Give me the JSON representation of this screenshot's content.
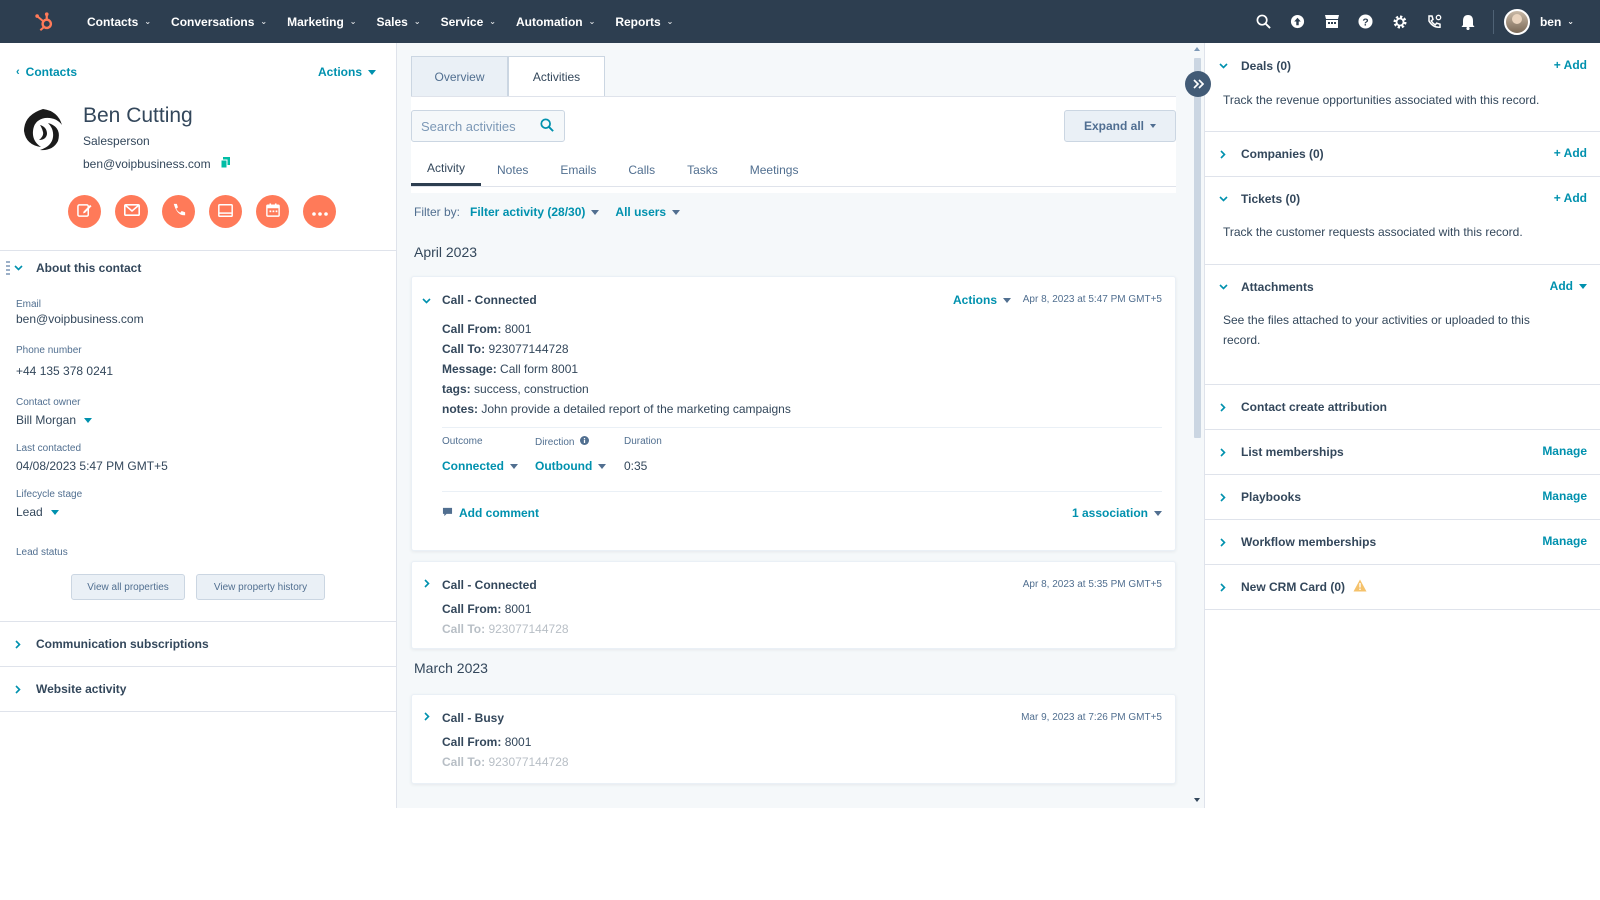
{
  "nav": {
    "items": [
      "Contacts",
      "Conversations",
      "Marketing",
      "Sales",
      "Service",
      "Automation",
      "Reports"
    ],
    "user": "ben",
    "icons": [
      "search-icon",
      "upgrade-icon",
      "marketplace-icon",
      "help-icon",
      "settings-icon",
      "calling-icon",
      "notifications-icon"
    ]
  },
  "left": {
    "back_label": "Contacts",
    "actions_label": "Actions",
    "name": "Ben Cutting",
    "role": "Salesperson",
    "email": "ben@voipbusiness.com",
    "action_icons": [
      "note-icon",
      "email-icon",
      "call-icon",
      "task-icon",
      "meeting-icon",
      "more-icon"
    ],
    "about_title": "About this contact",
    "properties": [
      {
        "label": "Email",
        "value": "ben@voipbusiness.com"
      },
      {
        "label": "Phone number",
        "value": "+44 135 378 0241"
      },
      {
        "label": "Contact owner",
        "value": "Bill Morgan"
      },
      {
        "label": "Last contacted",
        "value": "04/08/2023 5:47 PM GMT+5"
      },
      {
        "label": "Lifecycle stage",
        "value": "Lead"
      },
      {
        "label": "Lead status",
        "value": ""
      }
    ],
    "view_all": "View all properties",
    "view_history": "View property history",
    "sections": [
      "Communication subscriptions",
      "Website activity"
    ]
  },
  "middle": {
    "tabs": [
      "Overview",
      "Activities"
    ],
    "search_placeholder": "Search activities",
    "expand_all": "Expand all",
    "subtabs": [
      "Activity",
      "Notes",
      "Emails",
      "Calls",
      "Tasks",
      "Meetings"
    ],
    "filter_label": "Filter by:",
    "filter_activity": "Filter activity (28/30)",
    "all_users": "All users",
    "months": [
      "April 2023",
      "March 2023"
    ],
    "cards": [
      {
        "title": "Call - Connected",
        "actions": "Actions",
        "date": "Apr 8, 2023 at 5:47 PM GMT+5",
        "call_from_label": "Call From:",
        "call_from": "8001",
        "call_to_label": "Call To:",
        "call_to": "923077144728",
        "message_label": "Message:",
        "message": "Call form 8001",
        "tags_label": "tags:",
        "tags": "success, construction",
        "notes_label": "notes:",
        "notes": "John provide a detailed report of the marketing campaigns",
        "outcome_label": "Outcome",
        "outcome": "Connected",
        "direction_label": "Direction",
        "direction": "Outbound",
        "duration_label": "Duration",
        "duration": "0:35",
        "add_comment": "Add comment",
        "association": "1 association"
      },
      {
        "title": "Call - Connected",
        "date": "Apr 8, 2023 at 5:35 PM GMT+5",
        "call_from_label": "Call From:",
        "call_from": "8001",
        "call_to_label": "Call To:",
        "call_to": "923077144728"
      },
      {
        "title": "Call - Busy",
        "date": "Mar 9, 2023 at 7:26 PM GMT+5",
        "call_from_label": "Call From:",
        "call_from": "8001",
        "call_to_label": "Call To:",
        "call_to": "923077144728"
      }
    ]
  },
  "right": {
    "deals": {
      "title": "Deals (0)",
      "add": "+ Add",
      "text": "Track the revenue opportunities associated with this record."
    },
    "companies": {
      "title": "Companies (0)",
      "add": "+ Add"
    },
    "tickets": {
      "title": "Tickets (0)",
      "add": "+ Add",
      "text": "Track the customer requests associated with this record."
    },
    "attachments": {
      "title": "Attachments",
      "add": "Add",
      "text": "See the files attached to your activities or uploaded to this record."
    },
    "attribution": {
      "title": "Contact create attribution"
    },
    "lists": {
      "title": "List memberships",
      "action": "Manage"
    },
    "playbooks": {
      "title": "Playbooks",
      "action": "Manage"
    },
    "workflows": {
      "title": "Workflow memberships",
      "action": "Manage"
    },
    "crm_card": {
      "title": "New CRM Card (0)"
    }
  },
  "colors": {
    "nav_bg": "#2d3e50",
    "accent": "#ff7a59",
    "link": "#0091ae",
    "warning": "#f5c26b"
  }
}
